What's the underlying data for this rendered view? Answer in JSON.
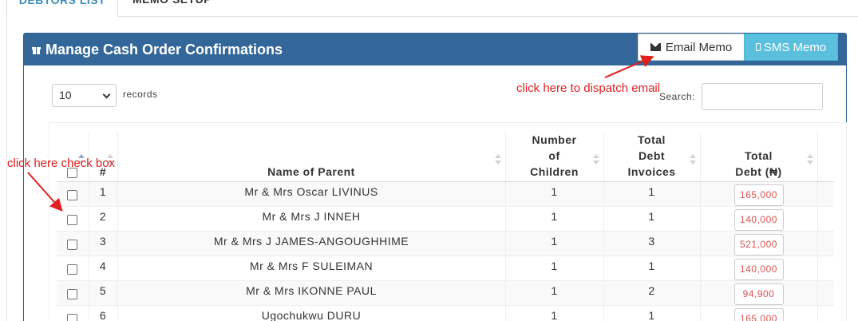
{
  "tabs": [
    {
      "label": "DEBTORS LIST",
      "active": true
    },
    {
      "label": "MEMO SETUP",
      "active": false
    }
  ],
  "panel": {
    "title": "Manage Cash Order Confirmations",
    "email_button": "Email Memo",
    "sms_button": "SMS Memo"
  },
  "controls": {
    "page_length": "10",
    "records_label": "records",
    "search_label": "Search:",
    "search_value": ""
  },
  "table": {
    "columns": {
      "index": "#",
      "parent_name": "Name of Parent",
      "num_children": [
        "Number",
        "of",
        "Children"
      ],
      "debt_invoices": [
        "Total",
        "Debt",
        "Invoices"
      ],
      "total_debt": [
        "Total",
        "Debt (₦)"
      ]
    },
    "rows": [
      {
        "index": "1",
        "parent_name": "Mr & Mrs Oscar LIVINUS",
        "num_children": "1",
        "debt_invoices": "1",
        "total_debt": "165,000"
      },
      {
        "index": "2",
        "parent_name": "Mr & Mrs J INNEH",
        "num_children": "1",
        "debt_invoices": "1",
        "total_debt": "140,000"
      },
      {
        "index": "3",
        "parent_name": "Mr & Mrs J JAMES-ANGOUGHHIME",
        "num_children": "1",
        "debt_invoices": "3",
        "total_debt": "521,000"
      },
      {
        "index": "4",
        "parent_name": "Mr & Mrs F SULEIMAN",
        "num_children": "1",
        "debt_invoices": "1",
        "total_debt": "140,000"
      },
      {
        "index": "5",
        "parent_name": "Mr & Mrs IKONNE PAUL",
        "num_children": "1",
        "debt_invoices": "2",
        "total_debt": "94,900"
      },
      {
        "index": "6",
        "parent_name": "Ugochukwu DURU",
        "num_children": "1",
        "debt_invoices": "1",
        "total_debt": "165,000"
      }
    ]
  },
  "annotations": {
    "email_hint": "click here to dispatch email",
    "checkbox_hint": "click here check box"
  },
  "colors": {
    "header_bg": "#336699",
    "sms_bg": "#5bc0de",
    "amount_text": "#d9534f",
    "annotation": "#e02020"
  }
}
